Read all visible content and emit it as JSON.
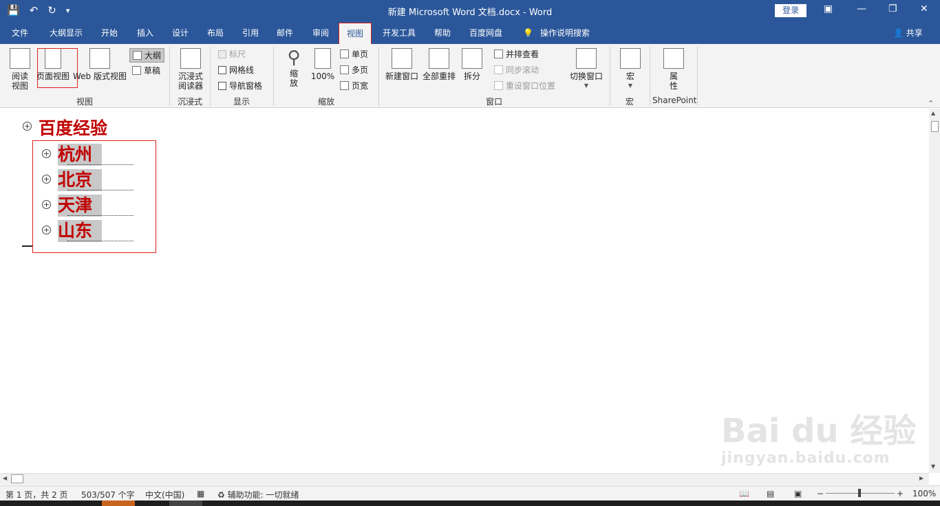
{
  "titlebar": {
    "title": "新建 Microsoft Word 文档.docx  -  Word",
    "login_label": "登录"
  },
  "tabs": [
    "文件",
    "大纲显示",
    "开始",
    "插入",
    "设计",
    "布局",
    "引用",
    "邮件",
    "审阅",
    "视图",
    "开发工具",
    "帮助",
    "百度网盘"
  ],
  "tell_me": "操作说明搜索",
  "share_label": "共享",
  "ribbon": {
    "views": {
      "read": "阅读\n视图",
      "print": "页面视图",
      "web": "Web 版式视图",
      "outline": "大纲",
      "draft": "草稿",
      "label": "视图"
    },
    "immersive": {
      "reader": "沉浸式\n阅读器",
      "label": "沉浸式"
    },
    "show": {
      "ruler": "标尺",
      "gridlines": "网格线",
      "nav_pane": "导航窗格",
      "label": "显示"
    },
    "zoom": {
      "zoom": "缩\n放",
      "hundred": "100%",
      "one_page": "单页",
      "multi_page": "多页",
      "page_width": "页宽",
      "label": "缩放"
    },
    "window": {
      "new_window": "新建窗口",
      "arrange_all": "全部重排",
      "split": "拆分",
      "side_by_side": "并排查看",
      "sync_scroll": "同步滚动",
      "reset_pos": "重设窗口位置",
      "switch": "切换窗口",
      "label": "窗口"
    },
    "macros": {
      "macros": "宏",
      "label": "宏"
    },
    "sharepoint": {
      "props": "属\n性",
      "label": "SharePoint"
    }
  },
  "document": {
    "heading": "百度经验",
    "items": [
      "杭州",
      "北京",
      "天津",
      "山东"
    ]
  },
  "status": {
    "page": "第 1 页，共 2 页",
    "words": "503/507 个字",
    "lang": "中文(中国)",
    "accessibility": "辅助功能: 一切就绪",
    "zoom": "100%"
  },
  "watermark": {
    "brand": "Bai du 经验",
    "url": "jingyan.baidu.com"
  }
}
